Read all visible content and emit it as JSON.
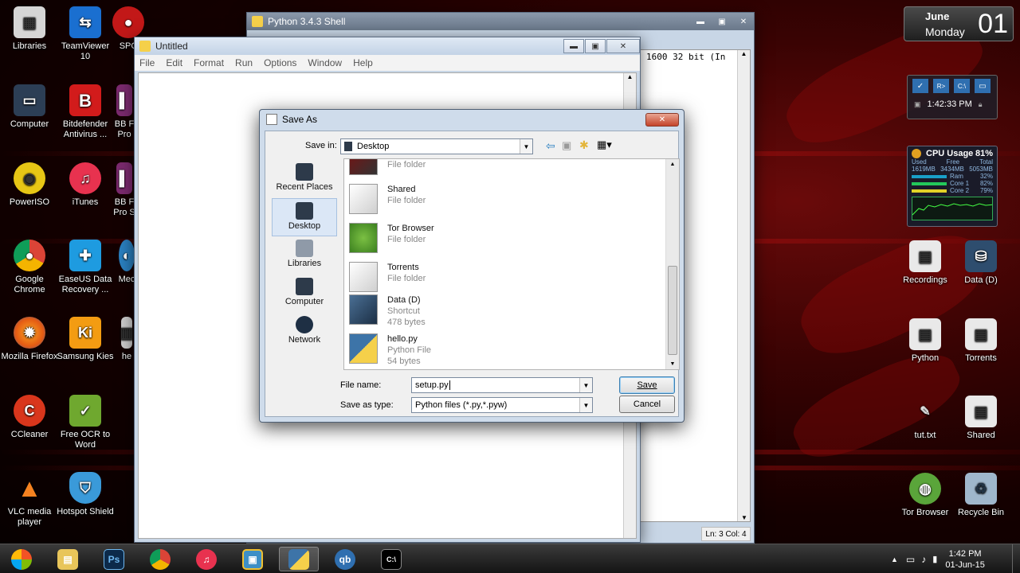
{
  "desktop_icons_left": [
    {
      "label": "Libraries"
    },
    {
      "label": "TeamViewer 10"
    },
    {
      "label": "SPC"
    },
    {
      "label": "Computer"
    },
    {
      "label": "Bitdefender Antivirus ..."
    },
    {
      "label": "BB F Pro"
    },
    {
      "label": "PowerISO"
    },
    {
      "label": "iTunes"
    },
    {
      "label": "BB F Pro S"
    },
    {
      "label": "Google Chrome"
    },
    {
      "label": "EaseUS Data Recovery ..."
    },
    {
      "label": "Mec"
    },
    {
      "label": "Mozilla Firefox"
    },
    {
      "label": "Samsung Kies"
    },
    {
      "label": "he"
    },
    {
      "label": "CCleaner"
    },
    {
      "label": "Free OCR to Word"
    },
    {
      "label": "VLC media player"
    },
    {
      "label": "Hotspot Shield"
    }
  ],
  "desktop_icons_right": [
    {
      "label": "Recordings"
    },
    {
      "label": "Data (D)"
    },
    {
      "label": "Python"
    },
    {
      "label": "Torrents"
    },
    {
      "label": "tut.txt"
    },
    {
      "label": "Shared"
    },
    {
      "label": "Tor Browser"
    },
    {
      "label": "Recycle Bin"
    }
  ],
  "gadgets": {
    "calendar": {
      "month": "June",
      "weekday": "Monday",
      "day": "01"
    },
    "clock": {
      "time": "1:42:33 PM"
    },
    "cpu": {
      "title": "CPU Usage",
      "percent": "81%",
      "used_label": "Used",
      "free_label": "Free",
      "total_label": "Total",
      "used": "1619MB",
      "free": "3434MB",
      "total": "5053MB",
      "ram_label": "Ram",
      "ram_pct": "32%",
      "core1_label": "Core 1",
      "core1_pct": "82%",
      "core2_label": "Core 2",
      "core2_pct": "79%"
    }
  },
  "shell_window": {
    "title": "Python 3.4.3 Shell",
    "visible_text": "1600 32 bit (In",
    "status": "Ln: 3 Col: 4"
  },
  "editor_window": {
    "title": "Untitled",
    "menu": [
      "File",
      "Edit",
      "Format",
      "Run",
      "Options",
      "Window",
      "Help"
    ]
  },
  "save_dialog": {
    "title": "Save As",
    "save_in_label": "Save in:",
    "save_in_value": "Desktop",
    "places": [
      "Recent Places",
      "Desktop",
      "Libraries",
      "Computer",
      "Network"
    ],
    "files": [
      {
        "name": "",
        "type": "File folder",
        "size": ""
      },
      {
        "name": "Shared",
        "type": "File folder",
        "size": ""
      },
      {
        "name": "Tor Browser",
        "type": "File folder",
        "size": ""
      },
      {
        "name": "Torrents",
        "type": "File folder",
        "size": ""
      },
      {
        "name": "Data (D)",
        "type": "Shortcut",
        "size": "478 bytes"
      },
      {
        "name": "hello.py",
        "type": "Python File",
        "size": "54 bytes"
      }
    ],
    "file_name_label": "File name:",
    "file_name_value": "setup.py",
    "save_type_label": "Save as type:",
    "save_type_value": "Python files (*.py,*.pyw)",
    "save_button": "Save",
    "cancel_button": "Cancel"
  },
  "taskbar": {
    "apps": [
      "start",
      "explorer",
      "photoshop",
      "chrome",
      "itunes",
      "archive",
      "python",
      "qbittorrent",
      "cmd"
    ],
    "tray_time": "1:42 PM",
    "tray_date": "01-Jun-15"
  }
}
